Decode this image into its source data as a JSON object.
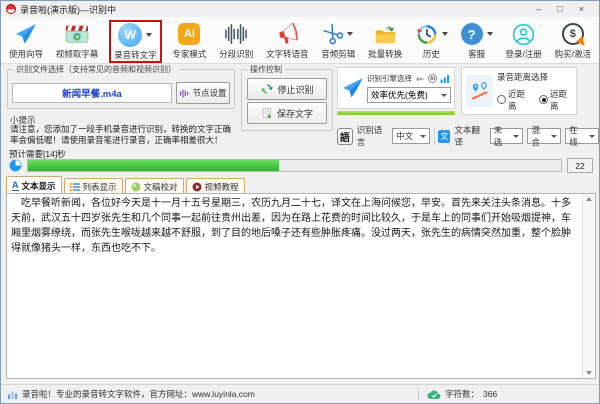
{
  "window": {
    "title": "录音啦(演示版)—识别中",
    "controls": {
      "minimize": "–",
      "maximize": "□",
      "close": "×"
    }
  },
  "toolbar": {
    "items": [
      {
        "label": "使用向导",
        "icon": "paper-plane-icon"
      },
      {
        "label": "视频取字幕",
        "icon": "video-subtitle-icon"
      },
      {
        "label": "录音转文字",
        "icon": "audio-to-text-icon",
        "highlighted": true,
        "dropdown": true
      },
      {
        "label": "专家模式",
        "icon": "ai-expert-icon"
      },
      {
        "label": "分段识别",
        "icon": "waveform-icon"
      },
      {
        "label": "文字转语音",
        "icon": "megaphone-icon"
      },
      {
        "label": "音频剪辑",
        "icon": "scissors-icon",
        "dropdown": true
      },
      {
        "label": "批量转换",
        "icon": "folder-convert-icon"
      },
      {
        "label": "历史",
        "icon": "history-clock-icon",
        "dropdown": true
      },
      {
        "label": "客服",
        "icon": "question-icon",
        "dropdown": true
      },
      {
        "label": "登录/注册",
        "icon": "user-icon"
      },
      {
        "label": "购买/激活",
        "icon": "buy-icon"
      }
    ]
  },
  "file_panel": {
    "legend": "识别文件选择（支持常见的音频和视频识别）",
    "file_name": "新闻早餐.m4a",
    "node_settings_label": "节点设置"
  },
  "tip": {
    "title": "小提示",
    "text": "请注意，您添加了一段手机录音进行识别，转换的文字正确率会偏低喔！请使用录音笔进行录音，正确率相差很大！"
  },
  "controls_panel": {
    "legend": "操作控制",
    "stop_label": "停止识别",
    "save_label": "保存文字"
  },
  "engine_panel": {
    "label": "识别引擎选择",
    "selected": "效率优先(免费)"
  },
  "distance_panel": {
    "label": "录音距离选择",
    "options": [
      {
        "label": "近距离",
        "checked": false
      },
      {
        "label": "远距离",
        "checked": true
      }
    ]
  },
  "language_row": {
    "lang_button": "語",
    "lang_label": "识别语言",
    "lang_value": "中文",
    "translate_label": "文本翻译",
    "translate_values": [
      "未选",
      "混合",
      "在线"
    ]
  },
  "progress": {
    "eta_label": "预计需要[14]秒",
    "percent": 47,
    "counter": "22"
  },
  "tabs": [
    {
      "label": "文本显示",
      "active": true
    },
    {
      "label": "列表显示",
      "active": false
    },
    {
      "label": "文稿校对",
      "active": false
    },
    {
      "label": "视频教程",
      "active": false
    }
  ],
  "transcript": {
    "text": "　吃早餐听新闻，各位好今天是十一月十五号星期三，农历九月二十七，译文在上海问候您，早安。首先来关注头条消息。十多天前，武汉五十四岁张先生和几个同事一起前往贵州出差，因为在路上花费的时间比较久，于是车上的同事们开始吸烟提神，车厢里烟雾缭绕，而张先生喉咙越来越不舒服，到了目的地后嗓子还有些肿胀疼痛。没过两天，张先生的病情突然加重，整个脸肿得就像猪头一样，东西也吃不下。"
  },
  "status_bar": {
    "left_text": "录音啦！专业的录音转文字软件，官方网址：www.luyinla.com",
    "char_count_label": "字符数：",
    "char_count": "366"
  },
  "glyphs": {
    "w": "W",
    "ai": "Ai",
    "ai_mini": "AI",
    "question": "?",
    "dollar": "$",
    "lang": "語",
    "translate": "文",
    "tab_a": "A"
  },
  "colors": {
    "highlight_red": "#cc1111",
    "progress_green": "#2fb52f",
    "engine_bar_green": "#76c41f",
    "file_name_blue": "#2045cf",
    "brand_blue": "#2196f3"
  }
}
